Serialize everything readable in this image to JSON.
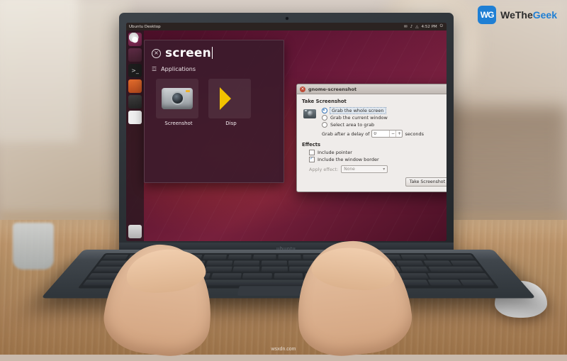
{
  "branding": {
    "logo_initials": "WG",
    "logo_text_we": "We",
    "logo_text_the": "The",
    "logo_text_geek": "Geek",
    "watermark": "wsxdn.com",
    "accent_color": "#1f7fd4"
  },
  "laptop": {
    "brand_label": "ubuntu"
  },
  "desktop": {
    "panel": {
      "title": "Ubuntu Desktop",
      "indicators": [
        "✉",
        "♪",
        "△",
        "⏻"
      ],
      "clock": "4:52 PM"
    },
    "launcher": {
      "items": [
        {
          "name": "ubuntu-dash-button",
          "glyph": "●"
        },
        {
          "name": "files-button",
          "glyph": "▤"
        },
        {
          "name": "terminal-button",
          "glyph": ">_"
        },
        {
          "name": "software-center-button",
          "glyph": "▲"
        },
        {
          "name": "amazon-button",
          "glyph": "a"
        },
        {
          "name": "documents-button",
          "glyph": "☰"
        },
        {
          "name": "trash-button",
          "glyph": "ᵜ"
        }
      ]
    },
    "dash": {
      "query": "screen",
      "clear_icon": "×",
      "category_icon": "☲",
      "category_label": "Applications",
      "results": [
        {
          "label": "Screenshot",
          "icon": "camera-icon"
        },
        {
          "label": "Disp",
          "icon": "display-icon"
        }
      ]
    },
    "screenshot_dialog": {
      "title": "gnome-screenshot",
      "close_glyph": "×",
      "section_take": "Take Screenshot",
      "options": [
        {
          "label": "Grab the whole screen",
          "selected": true
        },
        {
          "label": "Grab the current window",
          "selected": false
        },
        {
          "label": "Select area to grab",
          "selected": false
        }
      ],
      "delay_label": "Grab after a delay of",
      "delay_value": "0",
      "delay_minus": "−",
      "delay_plus": "+",
      "delay_units": "seconds",
      "section_effects": "Effects",
      "effects": [
        {
          "label": "Include pointer",
          "checked": false
        },
        {
          "label": "Include the window border",
          "checked": true
        }
      ],
      "apply_effect_label": "Apply effect:",
      "apply_effect_value": "None",
      "apply_effect_caret": "▾",
      "take_button": "Take Screenshot"
    }
  }
}
